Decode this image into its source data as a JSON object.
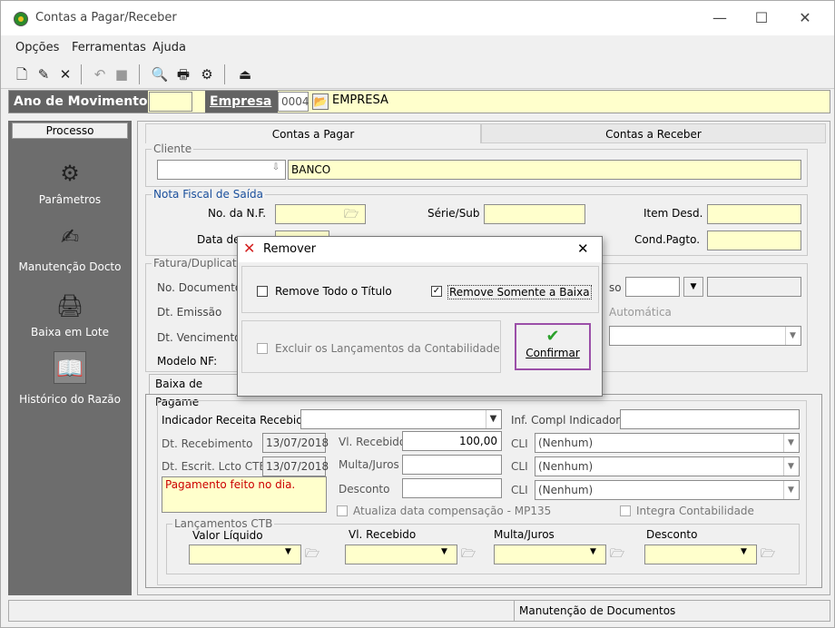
{
  "window": {
    "title": "Contas a Pagar/Receber",
    "minimize": "—",
    "maximize": "☐",
    "close": "✕"
  },
  "menu": [
    "Opções",
    "Ferramentas",
    "Ajuda"
  ],
  "header": {
    "ano_label": "Ano de Movimento",
    "ano_value": "",
    "empresa_label": "Empresa",
    "empresa_code": "0004",
    "empresa_name": "EMPRESA"
  },
  "sidebar": {
    "title": "Processo",
    "items": [
      {
        "label": "Parâmetros",
        "icon": "parameters-icon"
      },
      {
        "label": "Manutenção Docto",
        "icon": "document-maintenance-icon"
      },
      {
        "label": "Baixa em Lote",
        "icon": "batch-payment-icon"
      },
      {
        "label": "Histórico do Razão",
        "icon": "ledger-history-icon"
      }
    ]
  },
  "tabs": [
    "Contas a Pagar",
    "Contas a Receber"
  ],
  "cliente": {
    "label": "Cliente",
    "code": "",
    "name": "BANCO"
  },
  "nota_fiscal": {
    "label": "Nota Fiscal de Saída",
    "no_nf": "No. da N.F.",
    "data": "Data de",
    "serie": "Série/Sub",
    "item_desd": "Item Desd.",
    "cond_pagto": "Cond.Pagto."
  },
  "fatura": {
    "label": "Fatura/Duplicata",
    "no_documento": "No. Documento",
    "dt_emissao": "Dt. Emissão",
    "dt_vencimento": "Dt. Vencimento",
    "modelo_nf": "Modelo NF:",
    "partial_label": "so",
    "automatica": "Automática"
  },
  "baixa": {
    "tab_label": "Baixa de Pagame",
    "indicador_label": "Indicador Receita Recebida",
    "inf_compl_label": "Inf. Compl Indicador",
    "dt_recebimento_label": "Dt. Recebimento",
    "dt_recebimento": "13/07/2018",
    "dt_escrit_label": "Dt. Escrit. Lcto CTB",
    "dt_escrit": "13/07/2018",
    "vl_recebido_label": "Vl. Recebido",
    "vl_recebido": "100,00",
    "multa_label": "Multa/Juros",
    "desconto_label": "Desconto",
    "cli_label": "CLI",
    "cli_value": "(Nenhum)",
    "obs": "Pagamento feito no dia.",
    "atualiza": "Atualiza data compensação - MP135",
    "integra": "Integra Contabilidade"
  },
  "lancamentos": {
    "label": "Lançamentos CTB",
    "cols": [
      "Valor Líquido",
      "Vl. Recebido",
      "Multa/Juros",
      "Desconto"
    ]
  },
  "status": {
    "right": "Manutenção de Documentos"
  },
  "dialog": {
    "title": "Remover",
    "option1": "Remove Todo o Título",
    "option1_checked": false,
    "option2": "Remove Somente a Baixa",
    "option2_checked": true,
    "option3": "Excluir os Lançamentos da Contabilidade",
    "confirm": "Confirmar",
    "close": "✕"
  },
  "colors": {
    "field_yellow": "#ffffcc",
    "label_dark": "#636363",
    "sidebar": "#6d6d6d",
    "confirm_border": "#9b4fa8",
    "remove_red": "#d42020",
    "obs_red": "#cc0000"
  }
}
